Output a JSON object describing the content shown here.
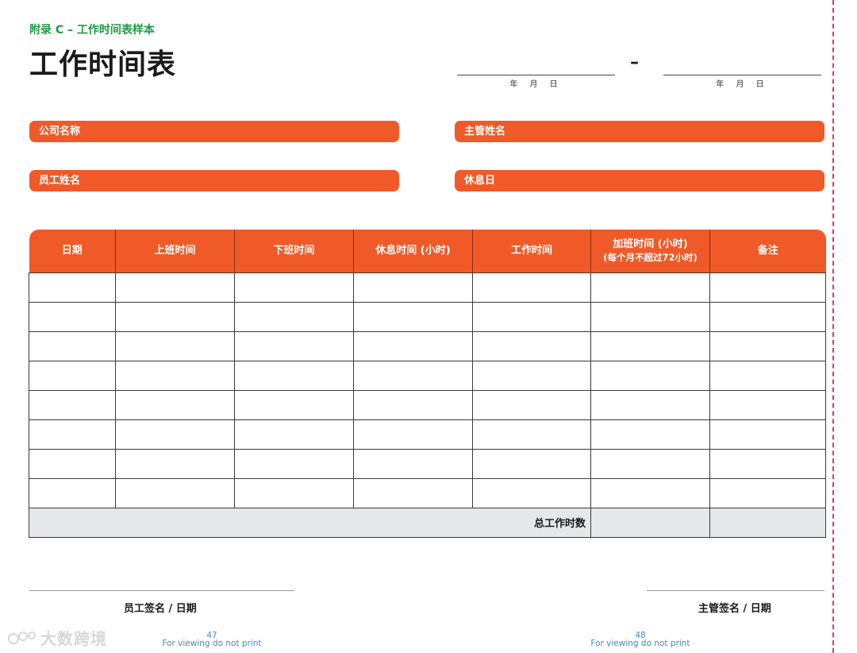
{
  "header": {
    "appendix": "附录 C – 工作时间表样本",
    "title": "工作时间表",
    "date_caption": "年 月 日",
    "date_dash": "–"
  },
  "fields": {
    "company_name": "公司名称",
    "supervisor_name": "主管姓名",
    "employee_name": "员工姓名",
    "rest_day": "休息日"
  },
  "table": {
    "columns": [
      "日期",
      "上班时间",
      "下班时间",
      "休息时间 (小时)",
      "工作时间",
      "加班时间 (小时)",
      "备注"
    ],
    "overtime_note": "(每个月不超过72小时)",
    "total_label": "总工作时数"
  },
  "signatures": {
    "employee": "员工签名 / 日期",
    "supervisor": "主管签名 / 日期"
  },
  "footer": {
    "page_left": "47",
    "page_right": "48",
    "notice": "For viewing do not print"
  },
  "watermark": "大数跨境",
  "colors": {
    "accent_orange": "#f05a28",
    "appendix_green": "#1f9a45",
    "total_row_gray": "#e6e7e9",
    "cut_line_magenta": "#e0338a"
  }
}
